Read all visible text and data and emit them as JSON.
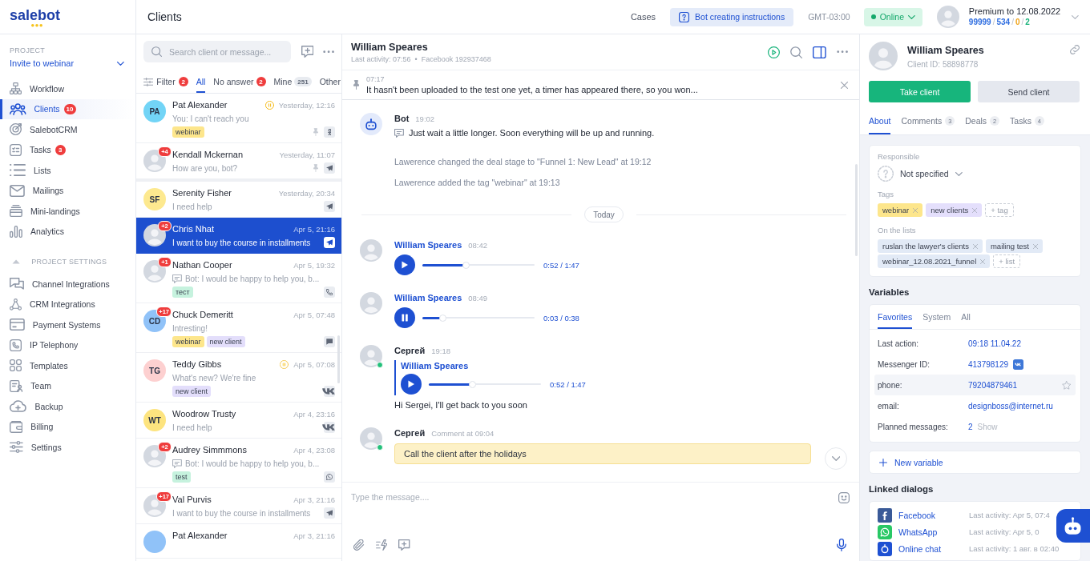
{
  "logo": {
    "text": "salebot"
  },
  "sidebar": {
    "project_label": "PROJECT",
    "project_name": "Invite to webinar",
    "items": [
      {
        "label": "Workflow",
        "selected": false
      },
      {
        "label": "Clients",
        "selected": true,
        "badge": "10"
      },
      {
        "label": "SalebotCRM",
        "selected": false
      },
      {
        "label": "Tasks",
        "selected": false,
        "badge": "3"
      },
      {
        "label": "Lists",
        "selected": false
      },
      {
        "label": "Mailings",
        "selected": false
      },
      {
        "label": "Mini-landings",
        "selected": false
      },
      {
        "label": "Analytics",
        "selected": false
      }
    ],
    "settings": {
      "title": "PROJECT SETTINGS",
      "expanded": true,
      "items": [
        {
          "label": "Channel Integrations",
          "selected": false
        },
        {
          "label": "CRM Integrations",
          "selected": false
        },
        {
          "label": "Payment Systems",
          "selected": false
        },
        {
          "label": "IP Telephony",
          "selected": false
        },
        {
          "label": "Templates",
          "selected": false
        },
        {
          "label": "Team",
          "selected": false
        },
        {
          "label": "Backup",
          "selected": false
        },
        {
          "label": "Billing",
          "selected": false
        },
        {
          "label": "Settings",
          "selected": false
        }
      ]
    }
  },
  "topbar": {
    "title": "Clients",
    "cases": "Cases",
    "instructions": "Bot creating instructions",
    "timezone": "GMT-03:00",
    "status": {
      "label": "Online",
      "online": true
    },
    "account": {
      "plan": "Premium to 12.08.2022",
      "separator": "/",
      "counters": [
        {
          "value": "99999",
          "color": "#2f6ee0"
        },
        {
          "value": "534",
          "color": "#2f6ee0"
        },
        {
          "value": "0",
          "color": "#f0a318"
        },
        {
          "value": "2",
          "color": "#18b27a"
        }
      ]
    }
  },
  "client_list": {
    "search_placeholder": "Search client or message...",
    "filter": {
      "label": "Filter",
      "badge": {
        "text": "2",
        "kind": "alert"
      }
    },
    "tabs": [
      {
        "label": "All",
        "selected": true
      },
      {
        "label": "No answer",
        "selected": false,
        "badge": {
          "text": "2",
          "kind": "alert"
        }
      },
      {
        "label": "Mine",
        "selected": false,
        "badge": {
          "text": "251",
          "kind": "count"
        }
      },
      {
        "label": "Other",
        "selected": false
      }
    ],
    "clients": [
      {
        "name": "Pat Alexander",
        "avatar": {
          "kind": "initials",
          "text": "PA",
          "color": "#72d4f6"
        },
        "time": "Yesterday, 12:16",
        "preview": "You: I can't reach you",
        "from_bot": false,
        "tags": [
          {
            "label": "webinar",
            "color": "#fde68c"
          }
        ],
        "status": {
          "kind": "paused"
        },
        "pinned": true,
        "channel": {
          "kind": "ok"
        },
        "selected": false
      },
      {
        "name": "Kendall Mckernan",
        "avatar": {
          "kind": "photo"
        },
        "unread": "+4",
        "time": "Yesterday, 11:07",
        "preview": "How are you, bot?",
        "from_bot": false,
        "pinned": true,
        "channel": {
          "kind": "telegram"
        },
        "selected": false
      },
      {
        "name": "Serenity Fisher",
        "avatar": {
          "kind": "initials",
          "text": "SF",
          "color": "#fde98f"
        },
        "time": "Yesterday, 20:34",
        "preview": "I need help",
        "from_bot": false,
        "pinned": false,
        "channel": {
          "kind": "telegram"
        },
        "selected": false
      },
      {
        "name": "Chris Nhat",
        "avatar": {
          "kind": "photo"
        },
        "unread": "+2",
        "time": "Apr 5, 21:16",
        "preview": "I want to buy the course in installments",
        "from_bot": false,
        "pinned": false,
        "channel": {
          "kind": "telegram"
        },
        "selected": true
      },
      {
        "name": "Nathan Cooper",
        "avatar": {
          "kind": "photo"
        },
        "unread": "+1",
        "time": "Apr 5, 19:32",
        "preview": "Bot: I would be happy to help you, b...",
        "from_bot": true,
        "tags": [
          {
            "label": "тест",
            "color": "#c6f2de"
          }
        ],
        "pinned": false,
        "channel": {
          "kind": "viber"
        },
        "selected": false
      },
      {
        "name": "Chuck Demeritt",
        "avatar": {
          "kind": "initials",
          "text": "CD",
          "color": "#90c2f8"
        },
        "unread": "+17",
        "time": "Apr 5, 07:48",
        "preview": "Intresting!",
        "from_bot": false,
        "tags": [
          {
            "label": "webinar",
            "color": "#fde68c"
          },
          {
            "label": "new client",
            "color": "#e3defb"
          }
        ],
        "pinned": false,
        "channel": {
          "kind": "chat"
        },
        "selected": false
      },
      {
        "name": "Teddy Gibbs",
        "avatar": {
          "kind": "initials",
          "text": "TG",
          "color": "#fdd0d0"
        },
        "time": "Apr 5, 07:08",
        "preview": "What's new? We're fine",
        "from_bot": false,
        "tags": [
          {
            "label": "new client",
            "color": "#e3defb"
          }
        ],
        "status": {
          "kind": "stopped"
        },
        "pinned": false,
        "channel": {
          "kind": "vk"
        },
        "selected": false
      },
      {
        "name": "Woodrow Trusty",
        "avatar": {
          "kind": "initials",
          "text": "WT",
          "color": "#fde47f"
        },
        "time": "Apr 4, 23:16",
        "preview": "I need help",
        "from_bot": false,
        "pinned": false,
        "channel": {
          "kind": "vk"
        },
        "selected": false
      },
      {
        "name": "Audrey Simmmons",
        "avatar": {
          "kind": "photo"
        },
        "unread": "+2",
        "time": "Apr 4, 23:08",
        "preview": "Bot: I would be happy to help you, b...",
        "from_bot": true,
        "tags": [
          {
            "label": "test",
            "color": "#c6f2de"
          }
        ],
        "pinned": false,
        "channel": {
          "kind": "whatsapp"
        },
        "selected": false
      },
      {
        "name": "Val Purvis",
        "avatar": {
          "kind": "photo"
        },
        "unread": "+17",
        "time": "Apr 3, 21:16",
        "preview": "I want to buy the course in installments",
        "from_bot": false,
        "pinned": false,
        "channel": {
          "kind": "telegram"
        },
        "selected": false
      },
      {
        "name": "Pat Alexander",
        "avatar": {
          "kind": "initials",
          "color": "#90c2f8"
        },
        "time": "Apr 3, 21:16",
        "from_bot": false,
        "pinned": false,
        "selected": false
      }
    ]
  },
  "chat": {
    "name": "William Speares",
    "subtitle": "Last activity: 07:56  •  Facebook 192937468",
    "pinned_message": {
      "time": "07:17",
      "text": "It hasn't been uploaded to the test one yet, a timer has appeared there, so you won..."
    },
    "messages": [
      {
        "kind": "bot",
        "author": "Bot",
        "time": "19:02",
        "from_client": false,
        "online": false,
        "text": "Just wait a little longer. Soon everything will be up and running."
      },
      {
        "kind": "event",
        "text": "Lawerence changed the deal stage to \"Funnel 1: New Lead\" at 19:12"
      },
      {
        "kind": "event",
        "text": "Lawerence added the tag \"webinar\" at 19:13"
      },
      {
        "kind": "divider",
        "text": "Today"
      },
      {
        "kind": "audio",
        "author": "William Speares",
        "time": "08:42",
        "from_client": true,
        "online": false,
        "audio": {
          "playing": false,
          "level": 0.38,
          "duration": "0:52 / 1:47"
        }
      },
      {
        "kind": "audio",
        "author": "William Speares",
        "time": "08:49",
        "from_client": true,
        "online": false,
        "audio": {
          "playing": true,
          "level": 0.16,
          "duration": "0:03 / 0:38"
        }
      },
      {
        "kind": "reply",
        "author": "Сергей",
        "time": "19:18",
        "from_client": false,
        "online": true,
        "quote": {
          "author": "William Speares",
          "audio": {
            "playing": false,
            "level": 0.38,
            "duration": "0:52 / 1:47"
          }
        },
        "text": "Hi Sergei, I'll get back to you soon"
      },
      {
        "kind": "comment",
        "author": "Сергей",
        "time": "Comment at 09:04",
        "from_client": false,
        "online": true,
        "text": "Call the client after the holidays"
      }
    ],
    "input_placeholder": "Type the message...."
  },
  "client_card": {
    "name": "William Speares",
    "client_id": "Client ID: 58898778",
    "actions": [
      {
        "label": "Take client",
        "kind": "primary"
      },
      {
        "label": "Send client",
        "kind": "secondary"
      }
    ],
    "tabs": [
      {
        "label": "About",
        "selected": true
      },
      {
        "label": "Comments",
        "count": "3",
        "selected": false
      },
      {
        "label": "Deals",
        "count": "2",
        "selected": false
      },
      {
        "label": "Tasks",
        "count": "4",
        "selected": false
      }
    ],
    "responsible": {
      "label": "Responsible",
      "value": "Not specified"
    },
    "tags": {
      "label": "Tags",
      "items": [
        {
          "label": "webinar",
          "color": "#fde68c"
        },
        {
          "label": "new clients",
          "color": "#e4dffc"
        }
      ],
      "add": "+ tag"
    },
    "lists": {
      "label": "On the lists",
      "items": [
        {
          "label": "ruslan the lawyer's clients"
        },
        {
          "label": "mailing test"
        },
        {
          "label": "webinar_12.08.2021_funnel"
        }
      ],
      "add": "+ list"
    }
  },
  "variables": {
    "title": "Variables",
    "tabs": [
      {
        "label": "Favorites",
        "selected": true
      },
      {
        "label": "System",
        "selected": false
      },
      {
        "label": "All",
        "selected": false
      }
    ],
    "rows": [
      {
        "label": "Last action:",
        "value": "09:18 11.04.22",
        "highlighted": false
      },
      {
        "label": "Messenger ID:",
        "value": "413798129",
        "channel": {
          "kind": "vk"
        },
        "highlighted": false
      },
      {
        "label": "phone:",
        "value": "79204879461",
        "highlighted": true
      },
      {
        "label": "email:",
        "value": "designboss@internet.ru",
        "highlighted": false
      },
      {
        "label": "Planned messages:",
        "value": "2",
        "action": "Show",
        "highlighted": false
      }
    ],
    "new_variable": "New variable"
  },
  "linked_dialogs": {
    "title": "Linked dialogs",
    "items": [
      {
        "kind": "facebook",
        "name": "Facebook",
        "activity": "Last activity: Apr 5, 07:4"
      },
      {
        "kind": "whatsapp",
        "name": "WhatsApp",
        "activity": "Last activity: Apr 5, 0"
      },
      {
        "kind": "chat",
        "name": "Online chat",
        "activity": "Last activity: 1 авг. в 02:40"
      }
    ]
  }
}
